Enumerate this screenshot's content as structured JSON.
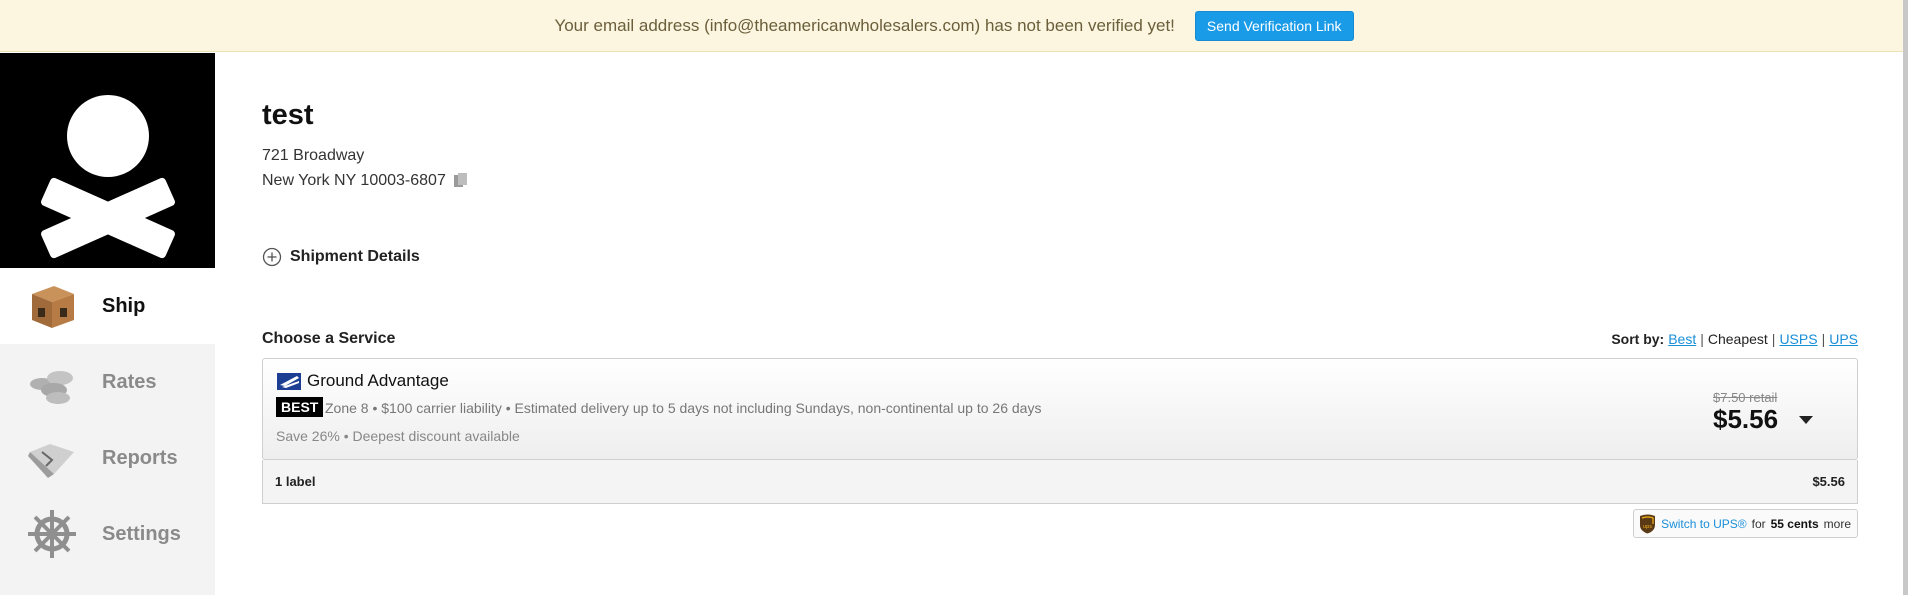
{
  "banner": {
    "message": "Your email address (info@theamericanwholesalers.com) has not been verified yet!",
    "button_label": "Send Verification Link"
  },
  "sidebar": {
    "logo_icon": "skull-crossbones-logo",
    "items": [
      {
        "label": "Ship",
        "icon": "box-icon",
        "active": true
      },
      {
        "label": "Rates",
        "icon": "coins-icon",
        "active": false
      },
      {
        "label": "Reports",
        "icon": "map-icon",
        "active": false
      },
      {
        "label": "Settings",
        "icon": "ship-wheel-icon",
        "active": false
      }
    ]
  },
  "recipient": {
    "name": "test",
    "address_line1": "721 Broadway",
    "address_line2": "New York NY 10003-6807"
  },
  "shipment_details_label": "Shipment Details",
  "services": {
    "heading": "Choose a Service",
    "sort_by_label": "Sort by:",
    "sort_options": [
      "Best",
      "Cheapest",
      "USPS",
      "UPS"
    ],
    "separator": "|",
    "selected": {
      "name": "Ground Advantage",
      "badge": "BEST",
      "details": "Zone 8 • $100 carrier liability • Estimated delivery up to 5 days not including Sundays, non-continental up to 26 days",
      "savings": "Save 26% • Deepest discount available",
      "retail_price": "$7.50 retail",
      "price": "$5.56"
    },
    "label_summary": {
      "count_label": "1 label",
      "total": "$5.56"
    },
    "ups_switch": {
      "link": "Switch to UPS®",
      "middle": "for",
      "amount": "55 cents",
      "suffix": "more"
    }
  },
  "colors": {
    "accent_blue": "#1a9be8",
    "banner_bg": "#fcf6e1",
    "sidebar_bg": "#f3f3f3"
  }
}
